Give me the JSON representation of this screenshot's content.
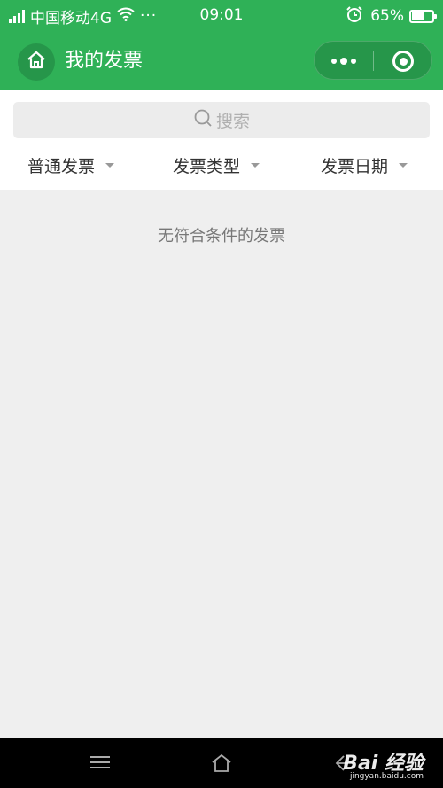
{
  "status_bar": {
    "carrier": "中国移动4G",
    "more": "···",
    "time": "09:01",
    "battery": "65%",
    "battery_level": 0.65
  },
  "nav": {
    "title": "我的发票"
  },
  "search": {
    "placeholder": "搜索"
  },
  "filters": [
    {
      "label": "普通发票"
    },
    {
      "label": "发票类型"
    },
    {
      "label": "发票日期"
    }
  ],
  "empty_message": "无符合条件的发票",
  "watermark": {
    "brand": "Bai 经验",
    "url": "jingyan.baidu.com"
  },
  "colors": {
    "brand_green": "#2fb157",
    "page_bg": "#efefef"
  }
}
